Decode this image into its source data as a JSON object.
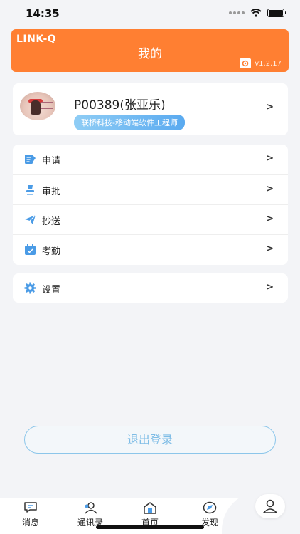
{
  "status": {
    "time": "14:35"
  },
  "header": {
    "brand": "LINK-Q",
    "title": "我的",
    "version": "v1.2.17"
  },
  "profile": {
    "name": "P00389(张亚乐)",
    "tag": "联桥科技-移动端软件工程师"
  },
  "menu": {
    "items": [
      {
        "label": "申请",
        "icon": "apply-icon"
      },
      {
        "label": "审批",
        "icon": "approve-icon"
      },
      {
        "label": "抄送",
        "icon": "cc-icon"
      },
      {
        "label": "考勤",
        "icon": "attendance-icon"
      }
    ]
  },
  "settings": {
    "label": "设置",
    "icon": "gear-icon"
  },
  "logout": {
    "label": "退出登录"
  },
  "tabbar": {
    "tabs": [
      {
        "label": "消息",
        "icon": "message-icon"
      },
      {
        "label": "通讯录",
        "icon": "contacts-icon"
      },
      {
        "label": "首页",
        "icon": "home-icon"
      },
      {
        "label": "发现",
        "icon": "discover-icon"
      }
    ],
    "active_icon": "profile-icon"
  },
  "colors": {
    "header_bg": "#ff7f32",
    "accent_blue": "#4a9be6",
    "tag_gradient": [
      "#8fcdf5",
      "#5aaaf0"
    ],
    "page_bg": "#f3f4f7"
  }
}
